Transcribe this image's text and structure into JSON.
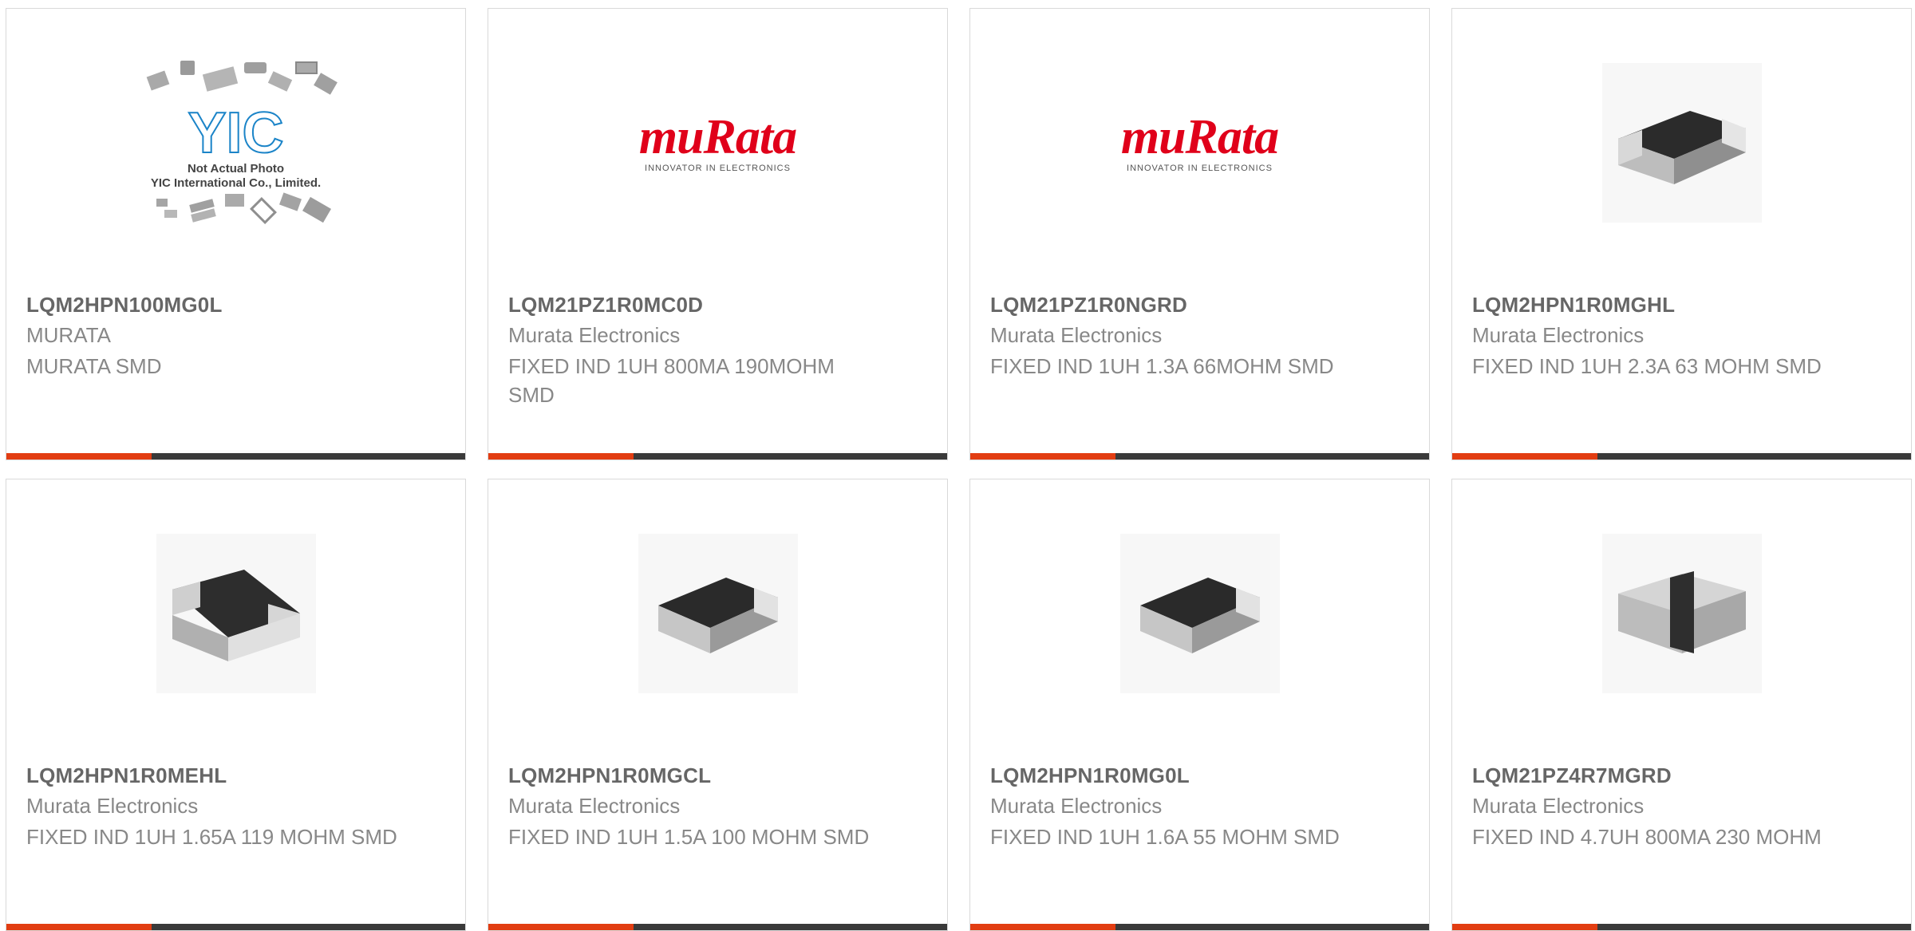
{
  "products": [
    {
      "part_number": "LQM2HPN100MG0L",
      "manufacturer": "MURATA",
      "description": "MURATA SMD",
      "image": "not-actual-photo",
      "logo": {
        "letters": "YIC",
        "caption_line1": "Not Actual Photo",
        "caption_line2": "YIC International Co., Limited."
      }
    },
    {
      "part_number": "LQM21PZ1R0MC0D",
      "manufacturer": "Murata Electronics",
      "description": "FIXED IND 1UH 800MA 190MOHM SMD",
      "image": "murata-logo",
      "logo": {
        "word": "muRata",
        "tagline": "INNOVATOR IN ELECTRONICS"
      }
    },
    {
      "part_number": "LQM21PZ1R0NGRD",
      "manufacturer": "Murata Electronics",
      "description": "FIXED IND 1UH 1.3A 66MOHM SMD",
      "image": "murata-logo",
      "logo": {
        "word": "muRata",
        "tagline": "INNOVATOR IN ELECTRONICS"
      }
    },
    {
      "part_number": "LQM2HPN1R0MGHL",
      "manufacturer": "Murata Electronics",
      "description": "FIXED IND 1UH 2.3A 63 MOHM SMD",
      "image": "smd-chip-photo"
    },
    {
      "part_number": "LQM2HPN1R0MEHL",
      "manufacturer": "Murata Electronics",
      "description": "FIXED IND 1UH 1.65A 119 MOHM SMD",
      "image": "smd-chip-photo"
    },
    {
      "part_number": "LQM2HPN1R0MGCL",
      "manufacturer": "Murata Electronics",
      "description": "FIXED IND 1UH 1.5A 100 MOHM SMD",
      "image": "smd-chip-photo"
    },
    {
      "part_number": "LQM2HPN1R0MG0L",
      "manufacturer": "Murata Electronics",
      "description": "FIXED IND 1UH 1.6A 55 MOHM SMD",
      "image": "smd-chip-photo"
    },
    {
      "part_number": "LQM21PZ4R7MGRD",
      "manufacturer": "Murata Electronics",
      "description": "FIXED IND 4.7UH 800MA 230 MOHM",
      "image": "smd-chip-photo"
    }
  ],
  "colors": {
    "accent": "#e23d12",
    "bar": "#3a3a3a",
    "murata_red": "#e0001a",
    "yic_blue": "#1b84c8"
  }
}
